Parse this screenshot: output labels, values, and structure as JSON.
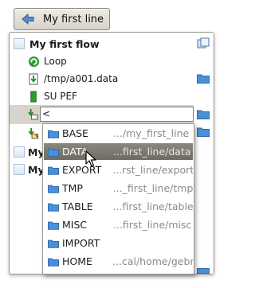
{
  "toolbar": {
    "back_label": "My first line"
  },
  "tree": {
    "flow_title": "My first flow",
    "children": [
      {
        "label": "Loop",
        "icon": "loop-icon"
      },
      {
        "label": "/tmp/a001.data",
        "icon": "download-icon"
      },
      {
        "label": "SU PEF",
        "icon": "program-icon"
      }
    ],
    "edit_value": "<",
    "other_rows": [
      {
        "label": "My"
      },
      {
        "label": "My"
      }
    ]
  },
  "dropdown": {
    "items": [
      {
        "name": "BASE",
        "path": ".../my_first_line"
      },
      {
        "name": "DATA",
        "path": "...first_line/data",
        "selected": true
      },
      {
        "name": "EXPORT",
        "path": "...rst_line/export"
      },
      {
        "name": "TMP",
        "path": "..._first_line/tmp"
      },
      {
        "name": "TABLE",
        "path": "...first_line/table"
      },
      {
        "name": "MISC",
        "path": "...first_line/misc"
      },
      {
        "name": "IMPORT",
        "path": ""
      },
      {
        "name": "HOME",
        "path": "...cal/home/gebr"
      }
    ]
  },
  "colors": {
    "selection": "#7c7970",
    "folder": "#4a8fd8",
    "loop_green": "#2e9b2e"
  }
}
